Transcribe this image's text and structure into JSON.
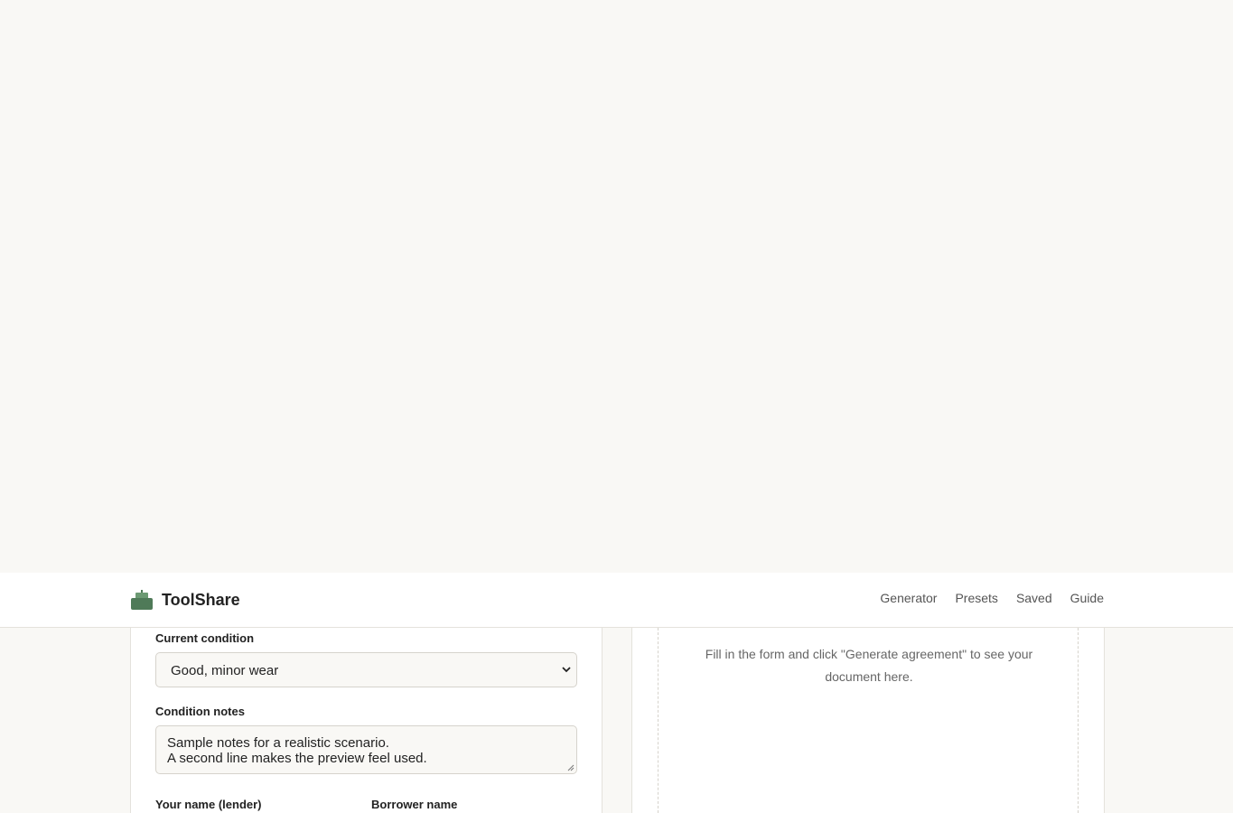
{
  "header": {
    "brand": "ToolShare",
    "nav": [
      "Generator",
      "Presets",
      "Saved",
      "Guide"
    ]
  },
  "form": {
    "condition_label": "Current condition",
    "condition_value": "Good, minor wear",
    "notes_label": "Condition notes",
    "notes_line1": "Sample notes for a realistic scenario.",
    "notes_line2": "A second line makes the preview feel used.",
    "lender_label": "Your name (lender)",
    "borrower_label": "Borrower name"
  },
  "preview": {
    "empty_message": "Fill in the form and click \"Generate agreement\" to see your document here."
  },
  "colors": {
    "brand_green": "#4f7a58",
    "background": "#f9f8f5"
  }
}
